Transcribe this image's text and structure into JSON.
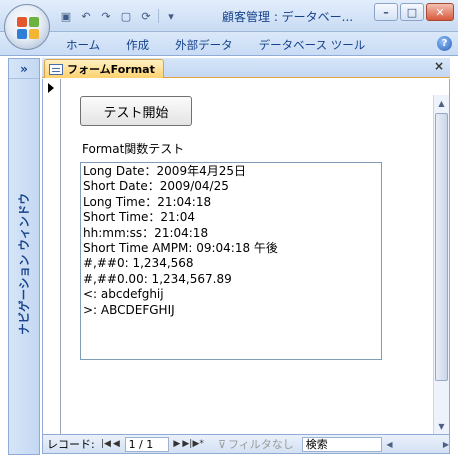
{
  "window": {
    "title": "顧客管理 : データベー...",
    "qat_icons": [
      "save-icon",
      "undo-icon",
      "redo-icon",
      "new-document-icon",
      "refresh-icon",
      "customize-qat-icon"
    ]
  },
  "ribbon": {
    "tabs": [
      "ホーム",
      "作成",
      "外部データ",
      "データベース ツール"
    ],
    "help": "?"
  },
  "navigation_pane": {
    "toggle": "»",
    "label": "ナビゲーション ウィンドウ"
  },
  "document_tab": {
    "label": "フォームFormat",
    "close": "×"
  },
  "form": {
    "start_button": "テスト開始",
    "caption": "Format関数テスト",
    "results": [
      "Long Date：2009年4月25日",
      "Short Date：2009/04/25",
      "Long Time：21:04:18",
      "Short Time：21:04",
      "hh:mm:ss：21:04:18",
      "Short Time AMPM: 09:04:18 午後",
      "#,##0: 1,234,568",
      "#,##0.00: 1,234,567.89",
      "<: abcdefghij",
      ">: ABCDEFGHIJ"
    ]
  },
  "record_nav": {
    "label": "レコード:",
    "position": "1 / 1",
    "filter": "フィルタなし",
    "search": "検索"
  }
}
